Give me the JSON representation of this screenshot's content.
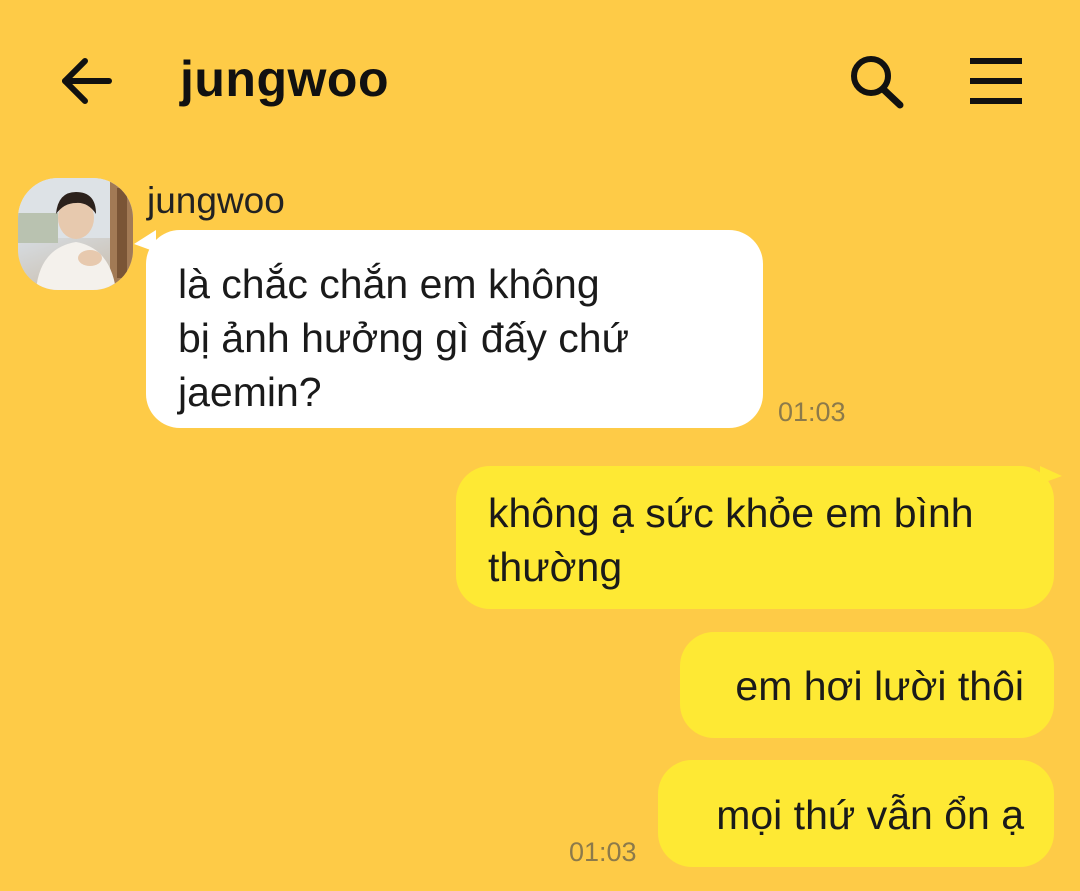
{
  "header": {
    "title": "jungwoo",
    "back_icon": "arrow-left-icon",
    "search_icon": "search-icon",
    "menu_icon": "menu-icon"
  },
  "messages": [
    {
      "direction": "incoming",
      "sender": "jungwoo",
      "avatar": "avatar-photo",
      "lines": [
        "là chắc chắn em không",
        "bị ảnh hưởng gì đấy chứ",
        "jaemin?"
      ],
      "time": "01:03"
    },
    {
      "direction": "outgoing",
      "lines": [
        "không ạ sức khỏe em bình",
        "thường"
      ]
    },
    {
      "direction": "outgoing",
      "lines": [
        "em hơi lười thôi"
      ]
    },
    {
      "direction": "outgoing",
      "lines": [
        "mọi thứ vẫn ổn ạ"
      ],
      "time": "01:03"
    }
  ],
  "colors": {
    "background": "#fecb47",
    "incoming_bubble": "#ffffff",
    "outgoing_bubble": "#fee934",
    "timestamp": "#8c7a4a"
  }
}
